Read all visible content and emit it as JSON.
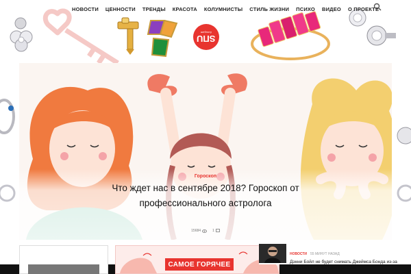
{
  "nav": {
    "items": [
      "НОВОСТИ",
      "ЦЕННОСТИ",
      "ТРЕНДЫ",
      "КРАСОТА",
      "КОЛУМНИСТЫ",
      "СТИЛЬ ЖИЗНИ",
      "ПСИХО",
      "ВИДЕО",
      "О ПРОЕКТЕ"
    ],
    "search_icon": "search-icon"
  },
  "logo": {
    "sub": "шеблогу",
    "main": "SПU"
  },
  "hero": {
    "category": "Гороскоп",
    "title": "Что ждет нас в сентябре 2018? Гороскоп от профессионального астролога",
    "views": "15684",
    "comments": "1",
    "views_icon": "eye-icon",
    "comments_icon": "comment-icon"
  },
  "promo": {
    "label": "САМОЕ ГОРЯЧЕЕ"
  },
  "news": {
    "category": "НОВОСТИ",
    "time": "55 МИНУТ НАЗАД",
    "title": "Дэнни Бойл не будет снимать Джеймса Бонда из-за конфликта с Дэниелом Крейгом"
  },
  "colors": {
    "accent": "#e8342f",
    "text": "#111111",
    "muted": "#777777"
  }
}
